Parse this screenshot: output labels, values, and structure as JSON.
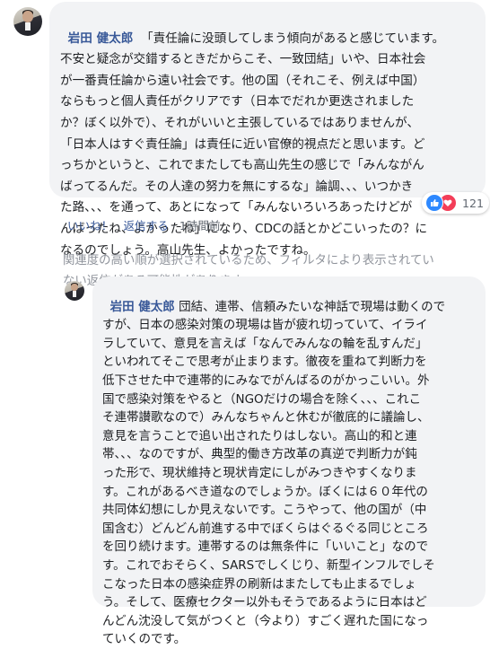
{
  "comment": {
    "author": "岩田 健太郎",
    "lines": [
      "「責任論に没頭してしまう傾向があると感じています。",
      "不安と疑念が交錯するときだからこそ、一致団結」いや、日本社会",
      "が一番責任論から遠い社会です。他の国（それこそ、例えば中国）",
      "ならもっと個人責任がクリアです（日本でだれか更迭されました",
      "か？ぼく以外で）、それがいいと主張しているではありませんが、",
      "「日本人はすぐ責任論」は責任に近い官僚的視点だと思います。ど",
      "っちかというと、これでまたしても高山先生の感じで「みんながん",
      "ばってるんだ。その人達の努力を無にするな」論調、、、いつかき",
      "た路、、、を通って、あとになって「みんないろいろあったけどが",
      "んばったね、よかったね」になり、CDCの話とかどこいったの？に",
      "なるのでしょう。高山先生、よかったですね。"
    ],
    "reaction_count": "121",
    "like_label": "いいね！",
    "separator": "·",
    "reply_label": "返信する",
    "time": "1時間前"
  },
  "filter_notice": [
    "関連度の高い順が選択されているため、フィルタにより表示されてい",
    "ない返信がある可能性があります。"
  ],
  "reply": {
    "author": "岩田 健太郎",
    "first_line": "団結、連帯、信頼みたいな神話で現場は動くので",
    "lines": [
      "すが、日本の感染対策の現場は皆が疲れ切っていて、イライ",
      "ラしていて、意見を言えば「なんでみんなの輪を乱すんだ」",
      "といわれてそこで思考が止まります。徹夜を重ねて判断力を",
      "低下させた中で連帯的にみなでがんばるのがかっこいい。外",
      "国で感染対策をやると（NGOだけの場合を除く、、、これこ",
      "そ連帯讃歌なので）みんなちゃんと休むが徹底的に議論し、",
      "意見を言うことで追い出されたりはしない。高山的和と連",
      "帯、、、なのですが、典型的働き方改革の真逆で判断力が鈍",
      "った形で、現状維持と現状肯定にしがみつきやすくなりま",
      "す。これがあるべき道なのでしょうか。ぼくには６０年代の",
      "共同体幻想にしか見えないです。こうやって、他の国が（中",
      "国含む）どんどん前進する中でぼくらはぐるぐる同じところ",
      "を回り続けます。連帯するのは無条件に「いいこと」なので",
      "す。これでおそらく、SARSでしくじり、新型インフルでしそ",
      "こなった日本の感染症界の刷新はまたしても止まるでしょ",
      "う。そして、医療セクター以外もそうであるように日本はど",
      "んどん沈没して気がつくと（今より）すごく遅れた国になっ",
      "ていくのです。"
    ]
  },
  "colors": {
    "bubble": "#f2f3f5",
    "link": "#385898",
    "meta": "#606770",
    "like": "#2d88ff",
    "love": "#f33e58"
  },
  "icons": [
    "avatar",
    "like-icon",
    "love-icon"
  ]
}
